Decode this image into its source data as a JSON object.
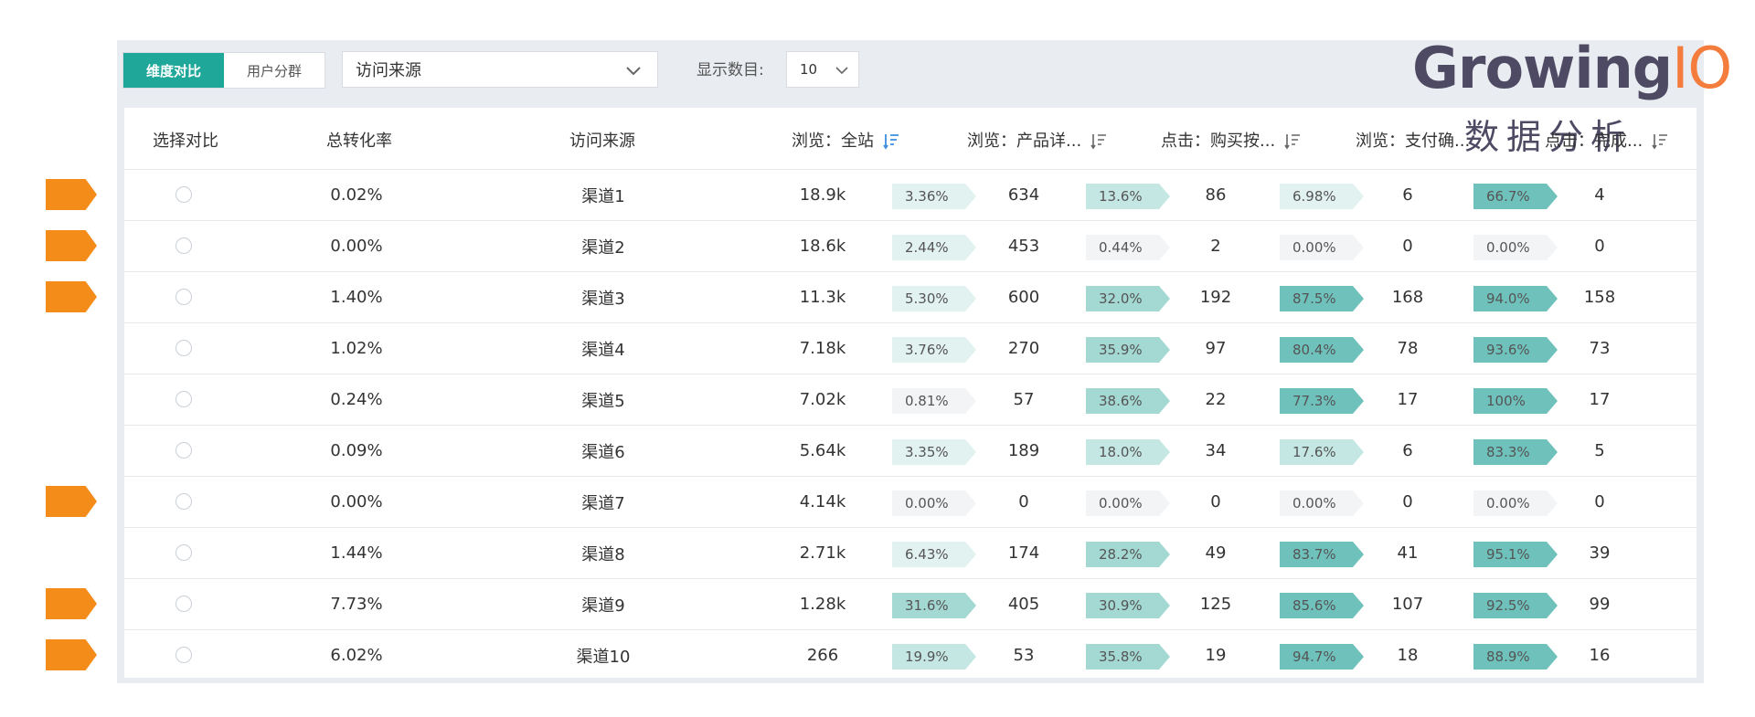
{
  "toolbar": {
    "tab_dimension": "维度对比",
    "tab_user": "用户分群",
    "select_value": "访问来源",
    "count_label": "显示数目:",
    "count_value": "10"
  },
  "logo": {
    "growing": "Growing",
    "io": "IO",
    "sub": "数据分析"
  },
  "headers": {
    "select": "选择对比",
    "rate": "总转化率",
    "source": "访问来源",
    "col1": "浏览：全站",
    "col2": "浏览：产品详...",
    "col3": "点击：购买按...",
    "col4": "浏览：支付确...",
    "col5": "点击：完成..."
  },
  "colors": {
    "accent": "#1fa79a",
    "marker": "#f48c1a",
    "sort_active": "#3d8fe0"
  },
  "rows": [
    {
      "rate": "0.02%",
      "source": "渠道1",
      "v1": "18.9k",
      "p1": "3.36%",
      "v2": "634",
      "p2": "13.6%",
      "v3": "86",
      "p3": "6.98%",
      "v4": "6",
      "p4": "66.7%",
      "v5": "4",
      "marked": true
    },
    {
      "rate": "0.00%",
      "source": "渠道2",
      "v1": "18.6k",
      "p1": "2.44%",
      "v2": "453",
      "p2": "0.44%",
      "v3": "2",
      "p3": "0.00%",
      "v4": "0",
      "p4": "0.00%",
      "v5": "0",
      "marked": true
    },
    {
      "rate": "1.40%",
      "source": "渠道3",
      "v1": "11.3k",
      "p1": "5.30%",
      "v2": "600",
      "p2": "32.0%",
      "v3": "192",
      "p3": "87.5%",
      "v4": "168",
      "p4": "94.0%",
      "v5": "158",
      "marked": true
    },
    {
      "rate": "1.02%",
      "source": "渠道4",
      "v1": "7.18k",
      "p1": "3.76%",
      "v2": "270",
      "p2": "35.9%",
      "v3": "97",
      "p3": "80.4%",
      "v4": "78",
      "p4": "93.6%",
      "v5": "73",
      "marked": false
    },
    {
      "rate": "0.24%",
      "source": "渠道5",
      "v1": "7.02k",
      "p1": "0.81%",
      "v2": "57",
      "p2": "38.6%",
      "v3": "22",
      "p3": "77.3%",
      "v4": "17",
      "p4": "100%",
      "v5": "17",
      "marked": false
    },
    {
      "rate": "0.09%",
      "source": "渠道6",
      "v1": "5.64k",
      "p1": "3.35%",
      "v2": "189",
      "p2": "18.0%",
      "v3": "34",
      "p3": "17.6%",
      "v4": "6",
      "p4": "83.3%",
      "v5": "5",
      "marked": false
    },
    {
      "rate": "0.00%",
      "source": "渠道7",
      "v1": "4.14k",
      "p1": "0.00%",
      "v2": "0",
      "p2": "0.00%",
      "v3": "0",
      "p3": "0.00%",
      "v4": "0",
      "p4": "0.00%",
      "v5": "0",
      "marked": true
    },
    {
      "rate": "1.44%",
      "source": "渠道8",
      "v1": "2.71k",
      "p1": "6.43%",
      "v2": "174",
      "p2": "28.2%",
      "v3": "49",
      "p3": "83.7%",
      "v4": "41",
      "p4": "95.1%",
      "v5": "39",
      "marked": false
    },
    {
      "rate": "7.73%",
      "source": "渠道9",
      "v1": "1.28k",
      "p1": "31.6%",
      "v2": "405",
      "p2": "30.9%",
      "v3": "125",
      "p3": "85.6%",
      "v4": "107",
      "p4": "92.5%",
      "v5": "99",
      "marked": true
    },
    {
      "rate": "6.02%",
      "source": "渠道10",
      "v1": "266",
      "p1": "19.9%",
      "v2": "53",
      "p2": "35.8%",
      "v3": "19",
      "p3": "94.7%",
      "v4": "18",
      "p4": "88.9%",
      "v5": "16",
      "marked": true
    }
  ]
}
